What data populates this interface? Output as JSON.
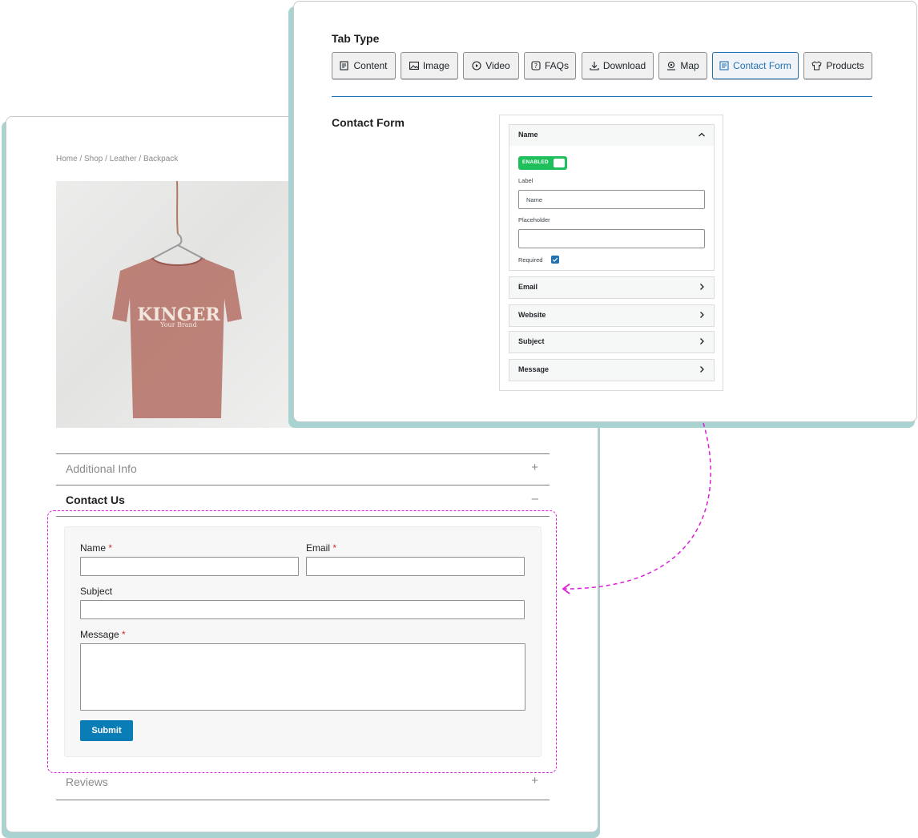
{
  "storefront": {
    "breadcrumb": "Home / Shop / Leather / Backpack",
    "product_image": {
      "brand_text": "KINGER",
      "brand_subtext": "Your Brand"
    },
    "accordion": {
      "additional_info": {
        "title": "Additional  Info",
        "sign": "+"
      },
      "contact_us": {
        "title": "Contact Us",
        "sign": "–"
      },
      "reviews": {
        "title": "Reviews",
        "sign": "+"
      }
    },
    "contact_form": {
      "name_label": "Name",
      "email_label": "Email",
      "subject_label": "Subject",
      "message_label": "Message",
      "required_mark": "*",
      "submit_label": "Submit"
    }
  },
  "settings": {
    "tab_type_title": "Tab Type",
    "tabs": [
      {
        "label": "Content",
        "icon": "content-icon"
      },
      {
        "label": "Image",
        "icon": "image-icon"
      },
      {
        "label": "Video",
        "icon": "video-play-icon"
      },
      {
        "label": "FAQs",
        "icon": "faq-icon"
      },
      {
        "label": "Download",
        "icon": "download-icon"
      },
      {
        "label": "Map",
        "icon": "map-pin-icon"
      },
      {
        "label": "Contact Form",
        "icon": "form-icon",
        "active": true
      },
      {
        "label": "Products",
        "icon": "shirt-icon"
      }
    ],
    "contact_form_heading": "Contact Form",
    "fields": {
      "name": {
        "title": "Name",
        "toggle_text": "ENABLED",
        "label_caption": "Label",
        "label_value": "Name",
        "placeholder_caption": "Placeholder",
        "placeholder_value": "",
        "required_caption": "Required",
        "required_checked": true
      },
      "email": {
        "title": "Email"
      },
      "website": {
        "title": "Website"
      },
      "subject": {
        "title": "Subject"
      },
      "message": {
        "title": "Message"
      }
    }
  },
  "colors": {
    "accent": "#2271b1",
    "submit": "#0b7db6",
    "toggle_on": "#1fbf5b",
    "highlight": "#d81fd8",
    "card_shadow": "#a9d3d1",
    "required": "#d32f2f"
  }
}
